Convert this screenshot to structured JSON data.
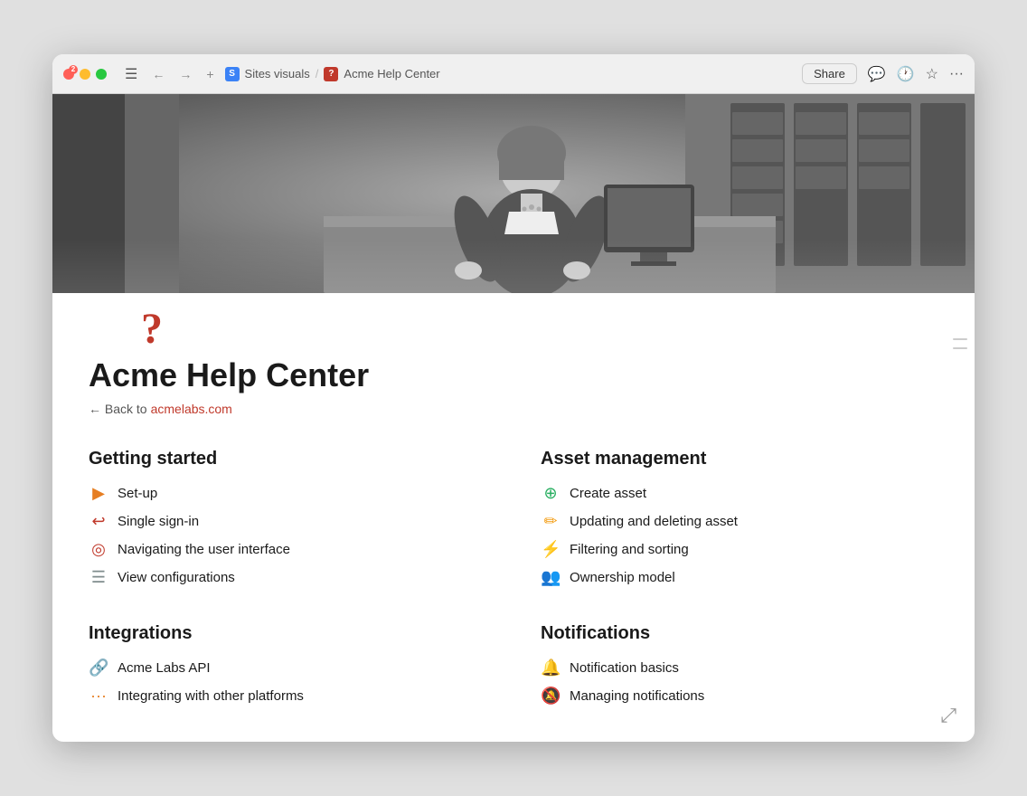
{
  "browser": {
    "badge": "2",
    "breadcrumb": {
      "sites": "Sites visuals",
      "separator": "/",
      "current": "Acme Help Center"
    },
    "share_label": "Share",
    "nav": {
      "back": "←",
      "forward": "→",
      "add": "+",
      "more": "···"
    }
  },
  "page": {
    "title": "Acme Help Center",
    "back_text": "← Back to",
    "back_link_text": "acmelabs.com",
    "icon": "?"
  },
  "sections": [
    {
      "id": "getting-started",
      "title": "Getting started",
      "links": [
        {
          "icon": "▶",
          "text": "Set-up",
          "icon_color": "#e67e22"
        },
        {
          "icon": "↩",
          "text": "Single sign-in",
          "icon_color": "#c0392b"
        },
        {
          "icon": "◎",
          "text": "Navigating the user interface",
          "icon_color": "#c0392b"
        },
        {
          "icon": "☰",
          "text": "View configurations",
          "icon_color": "#7f8c8d"
        }
      ]
    },
    {
      "id": "asset-management",
      "title": "Asset management",
      "links": [
        {
          "icon": "⊕",
          "text": "Create asset",
          "icon_color": "#27ae60"
        },
        {
          "icon": "✏",
          "text": "Updating and deleting asset",
          "icon_color": "#f39c12"
        },
        {
          "icon": "⚡",
          "text": "Filtering and sorting",
          "icon_color": "#e67e22"
        },
        {
          "icon": "👥",
          "text": "Ownership model",
          "icon_color": "#e67e22"
        }
      ]
    },
    {
      "id": "integrations",
      "title": "Integrations",
      "links": [
        {
          "icon": "🔗",
          "text": "Acme Labs API",
          "icon_color": "#e67e22"
        },
        {
          "icon": "···",
          "text": "Integrating with other platforms",
          "icon_color": "#e67e22"
        }
      ]
    },
    {
      "id": "notifications",
      "title": "Notifications",
      "links": [
        {
          "icon": "🔔",
          "text": "Notification basics",
          "icon_color": "#c0392b"
        },
        {
          "icon": "🔕",
          "text": "Managing notifications",
          "icon_color": "#888"
        }
      ]
    }
  ]
}
